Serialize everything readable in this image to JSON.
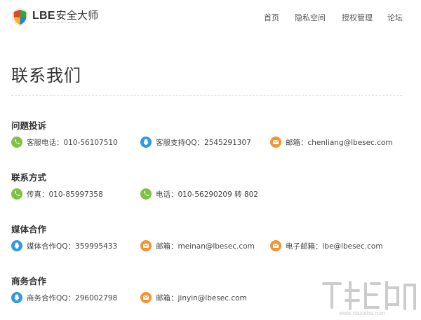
{
  "header": {
    "brand_en": "LBE",
    "brand_cn": "安全大师",
    "nav": [
      "首页",
      "隐私空间",
      "授权管理",
      "论坛"
    ]
  },
  "page": {
    "title": "联系我们"
  },
  "sections": [
    {
      "title": "问题投诉",
      "items": [
        {
          "icon": "phone-icon",
          "color": "#7dc242",
          "text": "客服电话：010-56107510"
        },
        {
          "icon": "qq-icon",
          "color": "#2e9ae3",
          "text": "客服支持QQ：2545291307"
        },
        {
          "icon": "mail-icon",
          "color": "#f39331",
          "text": "邮箱：chenliang@lbesec.com"
        }
      ]
    },
    {
      "title": "联系方式",
      "items": [
        {
          "icon": "phone-icon",
          "color": "#7dc242",
          "text": "传真：010-85997358"
        },
        {
          "icon": "phone-icon",
          "color": "#7dc242",
          "text": "电话：010-56290209 转 802"
        }
      ]
    },
    {
      "title": "媒体合作",
      "items": [
        {
          "icon": "qq-icon",
          "color": "#2e9ae3",
          "text": "媒体合作QQ：359995433"
        },
        {
          "icon": "mail-icon",
          "color": "#f39331",
          "text": "邮箱：meinan@lbesec.com"
        },
        {
          "icon": "mail-icon",
          "color": "#f39331",
          "text": "电子邮箱：lbe@lbesec.com"
        }
      ]
    },
    {
      "title": "商务合作",
      "items": [
        {
          "icon": "qq-icon",
          "color": "#2e9ae3",
          "text": "商务合作QQ：296002798"
        },
        {
          "icon": "mail-icon",
          "color": "#f39331",
          "text": "邮箱：jinyin@lbesec.com"
        }
      ]
    }
  ],
  "watermark": {
    "text": "www.xiazaiba.com"
  }
}
